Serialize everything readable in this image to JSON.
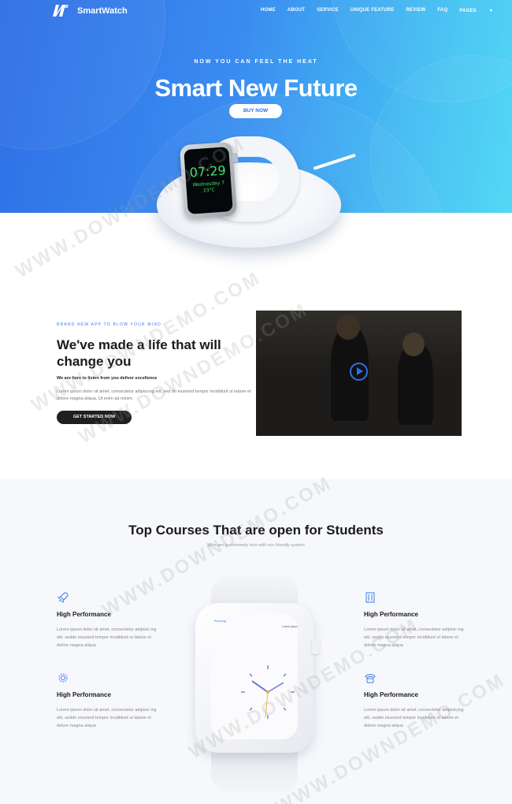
{
  "nav": {
    "brand": "SmartWatch",
    "items": [
      "HOME",
      "ABOUT",
      "SERVICE",
      "UNIQUE FEATURE",
      "REVIEW",
      "FAQ",
      "PAGES"
    ]
  },
  "hero": {
    "tagline": "NOW YOU CAN FEEL THE HEAT",
    "title": "Smart New Future",
    "button": "BUY NOW",
    "watch_time": "07:29",
    "watch_day": "Wednesday 7",
    "watch_temp": "23°C"
  },
  "about": {
    "eyebrow": "BRAND NEW APP TO BLOW YOUR MIND",
    "title": "We've made a life that will change you",
    "subtitle": "We are here to listen from you deliver excellence",
    "body": "Lorem ipsum dolor sit amet, consectetur adipiscing elit, sed do eiusmod tempor incididunt ut labore et dolore magna aliqua. Ut enim ad minim.",
    "button": "GET STARTED NOW"
  },
  "features": {
    "title": "Top Courses That are open for Students",
    "subtitle": "Who are in extremely love with eco friendly system",
    "items": [
      {
        "icon": "rocket-icon",
        "title": "High Performance",
        "text": "Lorem ipsum dolor sit amet, consectetur adipisic ing elit, seddo eiusmod tempor incididunt ut labore et dolore magna aliqua"
      },
      {
        "icon": "gear-icon",
        "title": "High Performance",
        "text": "Lorem ipsum dolor sit amet, consectetur adipisic ing elit, seddo eiusmod tempor incididunt ut labore et dolore magna aliqua"
      },
      {
        "icon": "building-icon",
        "title": "High Performance",
        "text": "Lorem ipsum dolor sit amet, consectetur adipisic ing elit, seddo eiusmod tempor incididunt ut labore et dolore magna aliqua"
      },
      {
        "icon": "phone-icon",
        "title": "High Performance",
        "text": "Lorem ipsum dolor sit amet, consectetur adipisic ing elit, seddo eiusmod tempor incididunt ut labore et dolore magna aliqua"
      }
    ],
    "watch_label": "Running",
    "watch_label2": "Lorem ipsum"
  },
  "watermark": "WWW.DOWNDEMO.COM",
  "colors": {
    "accent": "#3a7bea",
    "hero_start": "#2f6fe6",
    "hero_end": "#4cd8f5",
    "dark_button": "#1f1f1f"
  }
}
